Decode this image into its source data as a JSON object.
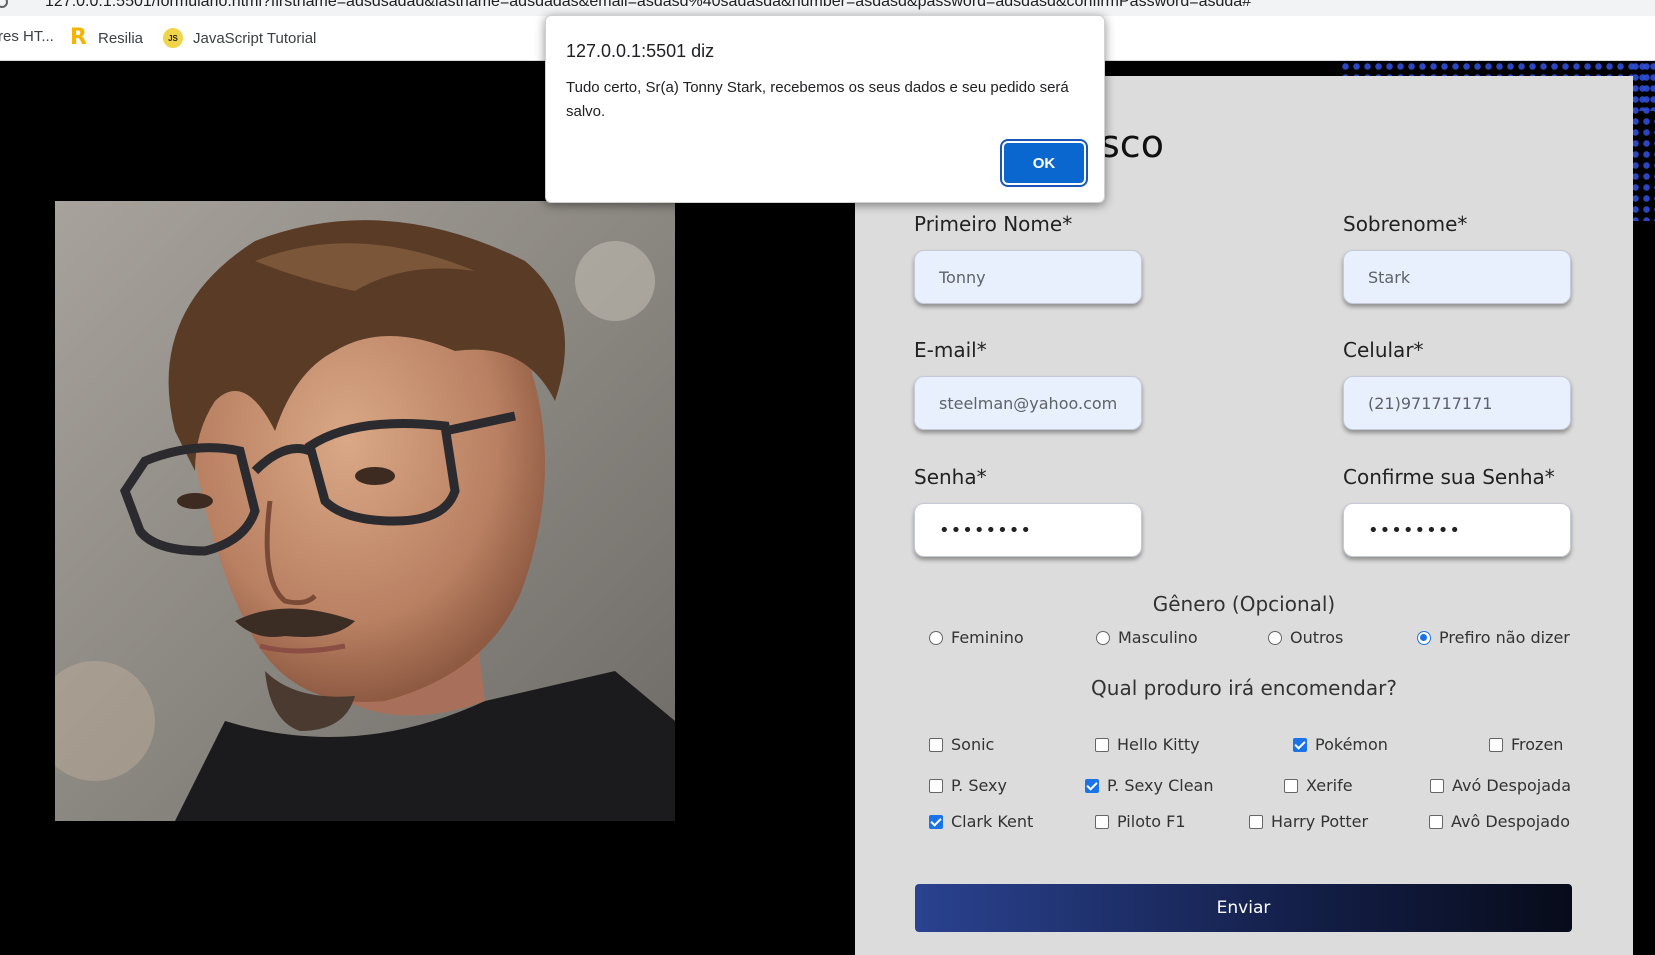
{
  "browser": {
    "url": "127.0.0.1:5501/formulario.html?firstname=adsdsadad&lastname=adsdadas&email=asdasd%40sadasda&number=asdasd&password=adsdasd&confirmPassword=asdda#",
    "bookmarks": [
      {
        "label": "res HT...",
        "icon": "page-icon"
      },
      {
        "label": "Resilia",
        "icon": "resilia-r-icon"
      },
      {
        "label": "JavaScript Tutorial",
        "icon": "js-icon"
      }
    ]
  },
  "dialog": {
    "title": "127.0.0.1:5501 diz",
    "message": "Tudo certo, Sr(a) Tonny  Stark, recebemos os seus dados e seu pedido será salvo.",
    "ok_label": "OK"
  },
  "form": {
    "title_fragment": "sco",
    "fields": {
      "first_name": {
        "label": "Primeiro Nome*",
        "value": "Tonny"
      },
      "last_name": {
        "label": "Sobrenome*",
        "value": "Stark"
      },
      "email": {
        "label": "E-mail*",
        "value": "steelman@yahoo.com"
      },
      "phone": {
        "label": "Celular*",
        "value": "(21)971717171"
      },
      "password": {
        "label": "Senha*",
        "value": "••••••••"
      },
      "confirm_password": {
        "label": "Confirme sua Senha*",
        "value": "••••••••"
      }
    },
    "gender": {
      "label": "Gênero (Opcional)",
      "options": [
        "Feminino",
        "Masculino",
        "Outros",
        "Prefiro não dizer"
      ],
      "selected": "Prefiro não dizer"
    },
    "products": {
      "label": "Qual produro irá encomendar?",
      "items": [
        {
          "label": "Sonic",
          "checked": false
        },
        {
          "label": "Hello Kitty",
          "checked": false
        },
        {
          "label": "Pokémon",
          "checked": true
        },
        {
          "label": "Frozen",
          "checked": false
        },
        {
          "label": "P. Sexy",
          "checked": false
        },
        {
          "label": "P. Sexy Clean",
          "checked": true
        },
        {
          "label": "Xerife",
          "checked": false
        },
        {
          "label": "Avó Despojada",
          "checked": false
        },
        {
          "label": "Clark Kent",
          "checked": true
        },
        {
          "label": "Piloto F1",
          "checked": false
        },
        {
          "label": "Harry Potter",
          "checked": false
        },
        {
          "label": "Avô Despojado",
          "checked": false
        }
      ]
    },
    "submit_label": "Enviar"
  },
  "colors": {
    "panel_bg": "#dcdcdc",
    "input_autofill_bg": "#e8f0fe",
    "accent": "#1a73e8",
    "button_gradient_start": "#2a4290",
    "button_gradient_end": "#070b1a"
  }
}
